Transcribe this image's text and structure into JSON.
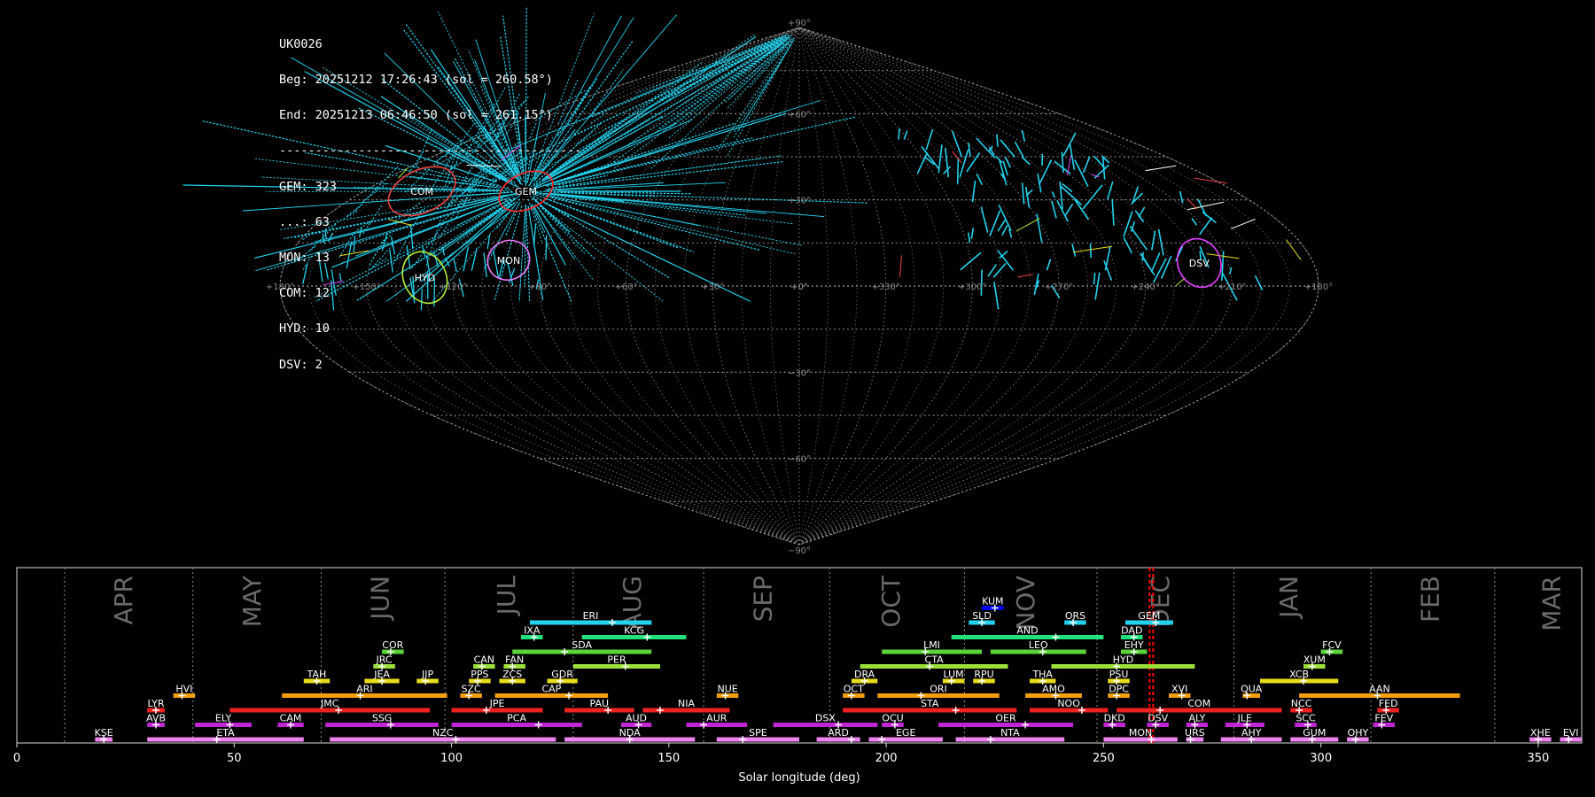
{
  "info": {
    "station": "UK0026",
    "beg": "Beg: 20251212 17:26:43 (sol = 260.58°)",
    "end": "End: 20251213 06:46:50 (sol = 261.15°)",
    "separator": "------------------------------------------",
    "counts": [
      "GEM: 323",
      "...: 63",
      "MON: 13",
      "COM: 12",
      "HYD: 10",
      "DSV: 2"
    ]
  },
  "colors": {
    "background": "#000000",
    "meteor_main": "#22d3ee",
    "grid": "#888888",
    "current_sol": "#ff0000"
  },
  "chart_data": [
    {
      "type": "scatter",
      "projection": "sinusoidal",
      "lon_range": [
        -180,
        180
      ],
      "lat_range": [
        -90,
        90
      ],
      "lon_labels": [
        "+180°",
        "+150°",
        "+120°",
        "+90°",
        "+60°",
        "+30°",
        "+0°",
        "+330°",
        "+300°",
        "+270°",
        "+240°",
        "+210°",
        "+180°"
      ],
      "lat_labels": [
        "+90°",
        "+60°",
        "+30°",
        "+0°",
        "−30°",
        "−60°",
        "−90°"
      ],
      "grid": true,
      "radiants": [
        {
          "code": "COM",
          "ra": 156,
          "dec": 33,
          "color": "#ef4444",
          "rx": 20,
          "ry": 12
        },
        {
          "code": "GEM",
          "ra": 113,
          "dec": 33,
          "color": "#ff2a2a",
          "rx": 16,
          "ry": 10
        },
        {
          "code": "MON",
          "ra": 102,
          "dec": 9,
          "color": "#e879f9",
          "rx": 12,
          "ry": 11
        },
        {
          "code": "HYD",
          "ra": 130,
          "dec": 3,
          "color": "#b5f23a",
          "rx": 12,
          "ry": 15
        },
        {
          "code": "DSV",
          "ra": 220,
          "dec": 8,
          "color": "#e040fb",
          "rx": 12,
          "ry": 14
        }
      ]
    },
    {
      "type": "timeline",
      "xlabel": "Solar longitude (deg)",
      "xlim": [
        0,
        360
      ],
      "xticks": [
        0,
        50,
        100,
        150,
        200,
        250,
        300,
        350
      ],
      "current_sol": 261,
      "months": [
        {
          "label": "APR",
          "x": 24.5,
          "boundary": 11
        },
        {
          "label": "MAY",
          "x": 54,
          "boundary": 40.5
        },
        {
          "label": "JUN",
          "x": 83.5,
          "boundary": 70
        },
        {
          "label": "JUL",
          "x": 112.5,
          "boundary": 98.5
        },
        {
          "label": "AUG",
          "x": 141.5,
          "boundary": 128
        },
        {
          "label": "SEP",
          "x": 171.5,
          "boundary": 158
        },
        {
          "label": "OCT",
          "x": 201,
          "boundary": 187
        },
        {
          "label": "NOV",
          "x": 232,
          "boundary": 218
        },
        {
          "label": "DEC",
          "x": 263,
          "boundary": 248.5
        },
        {
          "label": "JAN",
          "x": 292.5,
          "boundary": 280
        },
        {
          "label": "FEB",
          "x": 325,
          "boundary": 311.5
        },
        {
          "label": "MAR",
          "x": 353,
          "boundary": 340
        }
      ],
      "showers": [
        {
          "code": "KUM",
          "start": 222,
          "end": 227,
          "peak": 225,
          "row": 10,
          "color": "#0000ee"
        },
        {
          "code": "ERI",
          "start": 118,
          "end": 146,
          "peak": 137,
          "row": 9,
          "color": "#22d3ee"
        },
        {
          "code": "SLD",
          "start": 219,
          "end": 225,
          "peak": 222,
          "row": 9,
          "color": "#22d3ee"
        },
        {
          "code": "ORS",
          "start": 241,
          "end": 246,
          "peak": 243,
          "row": 9,
          "color": "#22d3ee"
        },
        {
          "code": "GEM",
          "start": 255,
          "end": 266,
          "peak": 262,
          "row": 9,
          "color": "#22d3ee"
        },
        {
          "code": "IXA",
          "start": 116,
          "end": 121,
          "peak": 119,
          "row": 8,
          "color": "#22e07a"
        },
        {
          "code": "KCG",
          "start": 130,
          "end": 154,
          "peak": 145,
          "row": 8,
          "color": "#22e07a"
        },
        {
          "code": "AND",
          "start": 215,
          "end": 250,
          "peak": 239,
          "row": 8,
          "color": "#22e07a"
        },
        {
          "code": "DAD",
          "start": 254,
          "end": 259,
          "peak": 257,
          "row": 8,
          "color": "#22e07a"
        },
        {
          "code": "COR",
          "start": 84,
          "end": 89,
          "peak": 86,
          "row": 7,
          "color": "#5ad43a"
        },
        {
          "code": "SDA",
          "start": 114,
          "end": 146,
          "peak": 126,
          "row": 7,
          "color": "#5ad43a"
        },
        {
          "code": "LMI",
          "start": 199,
          "end": 222,
          "peak": 209,
          "row": 7,
          "color": "#5ad43a"
        },
        {
          "code": "LEO",
          "start": 224,
          "end": 246,
          "peak": 236,
          "row": 7,
          "color": "#5ad43a"
        },
        {
          "code": "EHY",
          "start": 254,
          "end": 260,
          "peak": 257,
          "row": 7,
          "color": "#5ad43a"
        },
        {
          "code": "FCV",
          "start": 300,
          "end": 305,
          "peak": 302,
          "row": 7,
          "color": "#5ad43a"
        },
        {
          "code": "JRC",
          "start": 82,
          "end": 87,
          "peak": 84,
          "row": 6,
          "color": "#9be03a"
        },
        {
          "code": "CAN",
          "start": 105,
          "end": 110,
          "peak": 107,
          "row": 6,
          "color": "#9be03a"
        },
        {
          "code": "FAN",
          "start": 112,
          "end": 117,
          "peak": 114,
          "row": 6,
          "color": "#9be03a"
        },
        {
          "code": "PER",
          "start": 128,
          "end": 148,
          "peak": 140,
          "row": 6,
          "color": "#9be03a"
        },
        {
          "code": "CTA",
          "start": 194,
          "end": 228,
          "peak": 210,
          "row": 6,
          "color": "#9be03a"
        },
        {
          "code": "HYD",
          "start": 238,
          "end": 271,
          "peak": 253,
          "row": 6,
          "color": "#9be03a"
        },
        {
          "code": "XUM",
          "start": 296,
          "end": 301,
          "peak": 298,
          "row": 6,
          "color": "#9be03a"
        },
        {
          "code": "TAH",
          "start": 66,
          "end": 72,
          "peak": 69,
          "row": 5,
          "color": "#e8dd1a"
        },
        {
          "code": "JEA",
          "start": 80,
          "end": 88,
          "peak": 84,
          "row": 5,
          "color": "#e8dd1a"
        },
        {
          "code": "JIP",
          "start": 92,
          "end": 97,
          "peak": 94,
          "row": 5,
          "color": "#e8dd1a"
        },
        {
          "code": "PPS",
          "start": 104,
          "end": 109,
          "peak": 106,
          "row": 5,
          "color": "#e8dd1a"
        },
        {
          "code": "ZCS",
          "start": 111,
          "end": 117,
          "peak": 114,
          "row": 5,
          "color": "#e8dd1a"
        },
        {
          "code": "GDR",
          "start": 122,
          "end": 129,
          "peak": 125,
          "row": 5,
          "color": "#e8dd1a"
        },
        {
          "code": "DRA",
          "start": 192,
          "end": 198,
          "peak": 195,
          "row": 5,
          "color": "#e8dd1a"
        },
        {
          "code": "LUM",
          "start": 213,
          "end": 218,
          "peak": 215,
          "row": 5,
          "color": "#e8dd1a"
        },
        {
          "code": "RPU",
          "start": 220,
          "end": 225,
          "peak": 222,
          "row": 5,
          "color": "#e8dd1a"
        },
        {
          "code": "THA",
          "start": 233,
          "end": 239,
          "peak": 236,
          "row": 5,
          "color": "#e8dd1a"
        },
        {
          "code": "PSU",
          "start": 251,
          "end": 256,
          "peak": 253,
          "row": 5,
          "color": "#e8dd1a"
        },
        {
          "code": "XCB",
          "start": 286,
          "end": 304,
          "peak": 296,
          "row": 5,
          "color": "#e8dd1a"
        },
        {
          "code": "HVI",
          "start": 36,
          "end": 41,
          "peak": 38,
          "row": 4,
          "color": "#f59e0b"
        },
        {
          "code": "ARI",
          "start": 61,
          "end": 99,
          "peak": 79,
          "row": 4,
          "color": "#f59e0b"
        },
        {
          "code": "SZC",
          "start": 102,
          "end": 107,
          "peak": 104,
          "row": 4,
          "color": "#f59e0b"
        },
        {
          "code": "CAP",
          "start": 110,
          "end": 136,
          "peak": 127,
          "row": 4,
          "color": "#f59e0b"
        },
        {
          "code": "NUE",
          "start": 161,
          "end": 166,
          "peak": 163,
          "row": 4,
          "color": "#f59e0b"
        },
        {
          "code": "OCT",
          "start": 190,
          "end": 195,
          "peak": 192,
          "row": 4,
          "color": "#f59e0b"
        },
        {
          "code": "ORI",
          "start": 198,
          "end": 226,
          "peak": 208,
          "row": 4,
          "color": "#f59e0b"
        },
        {
          "code": "AMO",
          "start": 232,
          "end": 245,
          "peak": 239,
          "row": 4,
          "color": "#f59e0b"
        },
        {
          "code": "DPC",
          "start": 251,
          "end": 256,
          "peak": 253,
          "row": 4,
          "color": "#f59e0b"
        },
        {
          "code": "XVI",
          "start": 265,
          "end": 270,
          "peak": 268,
          "row": 4,
          "color": "#f59e0b"
        },
        {
          "code": "QUA",
          "start": 282,
          "end": 286,
          "peak": 283,
          "row": 4,
          "color": "#f59e0b"
        },
        {
          "code": "AAN",
          "start": 295,
          "end": 332,
          "peak": 313,
          "row": 4,
          "color": "#f59e0b"
        },
        {
          "code": "LYR",
          "start": 30,
          "end": 34,
          "peak": 32,
          "row": 3,
          "color": "#ef2222"
        },
        {
          "code": "JMC",
          "start": 49,
          "end": 95,
          "peak": 74,
          "row": 3,
          "color": "#ef2222"
        },
        {
          "code": "JPE",
          "start": 100,
          "end": 121,
          "peak": 108,
          "row": 3,
          "color": "#ef2222"
        },
        {
          "code": "PAU",
          "start": 126,
          "end": 142,
          "peak": 136,
          "row": 3,
          "color": "#ef2222"
        },
        {
          "code": "NIA",
          "start": 144,
          "end": 164,
          "peak": 148,
          "row": 3,
          "color": "#ef2222"
        },
        {
          "code": "STA",
          "start": 190,
          "end": 230,
          "peak": 216,
          "row": 3,
          "color": "#ef2222"
        },
        {
          "code": "NOO",
          "start": 233,
          "end": 251,
          "peak": 245,
          "row": 3,
          "color": "#ef2222"
        },
        {
          "code": "COM",
          "start": 253,
          "end": 291,
          "peak": 263,
          "row": 3,
          "color": "#ef2222"
        },
        {
          "code": "NCC",
          "start": 293,
          "end": 298,
          "peak": 295,
          "row": 3,
          "color": "#ef2222"
        },
        {
          "code": "FED",
          "start": 313,
          "end": 318,
          "peak": 315,
          "row": 3,
          "color": "#ef2222"
        },
        {
          "code": "AVB",
          "start": 30,
          "end": 34,
          "peak": 32,
          "row": 2,
          "color": "#c026d3"
        },
        {
          "code": "ELY",
          "start": 41,
          "end": 54,
          "peak": 49,
          "row": 2,
          "color": "#c026d3"
        },
        {
          "code": "CAM",
          "start": 60,
          "end": 66,
          "peak": 63,
          "row": 2,
          "color": "#c026d3"
        },
        {
          "code": "SSG",
          "start": 71,
          "end": 97,
          "peak": 86,
          "row": 2,
          "color": "#c026d3"
        },
        {
          "code": "PCA",
          "start": 100,
          "end": 130,
          "peak": 120,
          "row": 2,
          "color": "#c026d3"
        },
        {
          "code": "AUD",
          "start": 139,
          "end": 146,
          "peak": 143,
          "row": 2,
          "color": "#c026d3"
        },
        {
          "code": "AUR",
          "start": 154,
          "end": 168,
          "peak": 158,
          "row": 2,
          "color": "#c026d3"
        },
        {
          "code": "DSX",
          "start": 174,
          "end": 198,
          "peak": 189,
          "row": 2,
          "color": "#c026d3"
        },
        {
          "code": "OCU",
          "start": 199,
          "end": 204,
          "peak": 202,
          "row": 2,
          "color": "#c026d3"
        },
        {
          "code": "OER",
          "start": 212,
          "end": 243,
          "peak": 232,
          "row": 2,
          "color": "#c026d3"
        },
        {
          "code": "DKD",
          "start": 250,
          "end": 255,
          "peak": 252,
          "row": 2,
          "color": "#c026d3"
        },
        {
          "code": "DSV",
          "start": 260,
          "end": 265,
          "peak": 262,
          "row": 2,
          "color": "#c026d3"
        },
        {
          "code": "ALY",
          "start": 269,
          "end": 274,
          "peak": 271,
          "row": 2,
          "color": "#c026d3"
        },
        {
          "code": "JLE",
          "start": 278,
          "end": 287,
          "peak": 283,
          "row": 2,
          "color": "#c026d3"
        },
        {
          "code": "SCC",
          "start": 294,
          "end": 299,
          "peak": 297,
          "row": 2,
          "color": "#c026d3"
        },
        {
          "code": "FEV",
          "start": 312,
          "end": 317,
          "peak": 314,
          "row": 2,
          "color": "#c026d3"
        },
        {
          "code": "KSE",
          "start": 18,
          "end": 22,
          "peak": 20,
          "row": 1,
          "color": "#ee82ee"
        },
        {
          "code": "ETA",
          "start": 30,
          "end": 66,
          "peak": 46,
          "row": 1,
          "color": "#ee82ee"
        },
        {
          "code": "NZC",
          "start": 72,
          "end": 124,
          "peak": 101,
          "row": 1,
          "color": "#ee82ee"
        },
        {
          "code": "NDA",
          "start": 126,
          "end": 156,
          "peak": 141,
          "row": 1,
          "color": "#ee82ee"
        },
        {
          "code": "SPE",
          "start": 161,
          "end": 180,
          "peak": 167,
          "row": 1,
          "color": "#ee82ee"
        },
        {
          "code": "ARD",
          "start": 184,
          "end": 194,
          "peak": 192,
          "row": 1,
          "color": "#ee82ee"
        },
        {
          "code": "EGE",
          "start": 196,
          "end": 213,
          "peak": 199,
          "row": 1,
          "color": "#ee82ee"
        },
        {
          "code": "NTA",
          "start": 216,
          "end": 241,
          "peak": 224,
          "row": 1,
          "color": "#ee82ee"
        },
        {
          "code": "MON",
          "start": 250,
          "end": 267,
          "peak": 261,
          "row": 1,
          "color": "#ee82ee"
        },
        {
          "code": "URS",
          "start": 269,
          "end": 273,
          "peak": 270,
          "row": 1,
          "color": "#ee82ee"
        },
        {
          "code": "AHY",
          "start": 277,
          "end": 291,
          "peak": 284,
          "row": 1,
          "color": "#ee82ee"
        },
        {
          "code": "GUM",
          "start": 293,
          "end": 304,
          "peak": 298,
          "row": 1,
          "color": "#ee82ee"
        },
        {
          "code": "OHY",
          "start": 306,
          "end": 311,
          "peak": 308,
          "row": 1,
          "color": "#ee82ee"
        },
        {
          "code": "XHE",
          "start": 348,
          "end": 353,
          "peak": 350,
          "row": 1,
          "color": "#ee82ee"
        },
        {
          "code": "EVI",
          "start": 355,
          "end": 360,
          "peak": 357,
          "row": 1,
          "color": "#ee82ee"
        }
      ]
    }
  ]
}
